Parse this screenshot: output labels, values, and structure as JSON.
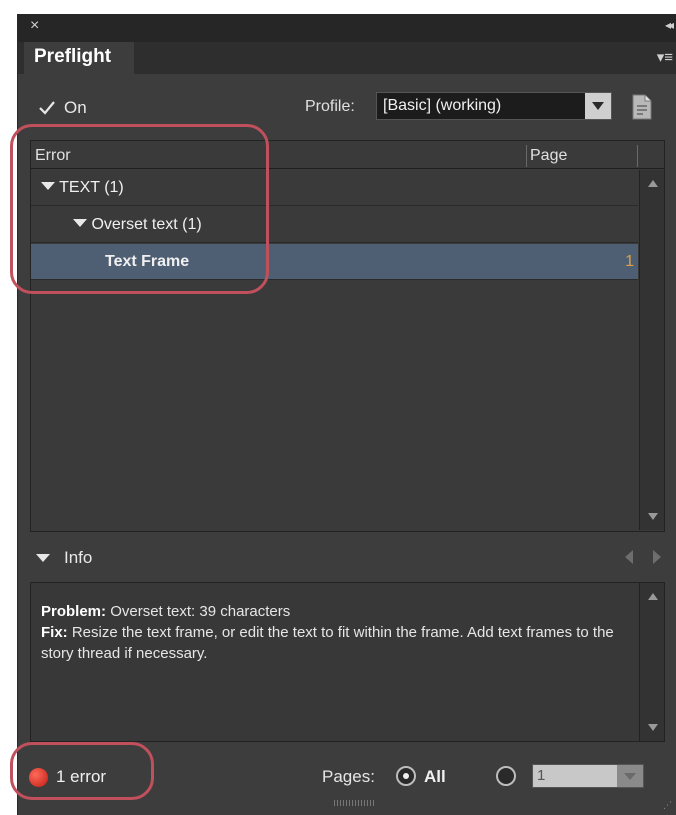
{
  "window": {
    "close_glyph": "×",
    "collapse_glyph": "◂◂",
    "menu_glyph": "▾≡"
  },
  "tabs": [
    {
      "label": "Preflight",
      "active": true
    }
  ],
  "toolbar": {
    "on_label": "On",
    "on_checked": true,
    "profile_label": "Profile:",
    "profile_value": "[Basic] (working)"
  },
  "list": {
    "columns": {
      "error": "Error",
      "page": "Page"
    },
    "rows": [
      {
        "label": "TEXT (1)",
        "level": 0,
        "expanded": true,
        "selected": false,
        "page": ""
      },
      {
        "label": "Overset text (1)",
        "level": 1,
        "expanded": true,
        "selected": false,
        "page": ""
      },
      {
        "label": "Text Frame",
        "level": 2,
        "expanded": false,
        "selected": true,
        "page": "1"
      }
    ]
  },
  "info": {
    "label": "Info",
    "problem_label": "Problem:",
    "problem_text": "Overset text: 39 characters",
    "fix_label": "Fix:",
    "fix_text": "Resize the text frame, or edit the text to fit within the frame. Add text frames to the story thread if necessary."
  },
  "status": {
    "error_text": "1 error",
    "pages_label": "Pages:",
    "all_label": "All",
    "all_selected": true,
    "range_value": "1"
  },
  "colors": {
    "panel_bg": "#3d3d3d",
    "selected_row": "#4f5f73",
    "error_red": "#d22b1f",
    "page_number": "#e0a040",
    "callout": "#c0505c"
  }
}
